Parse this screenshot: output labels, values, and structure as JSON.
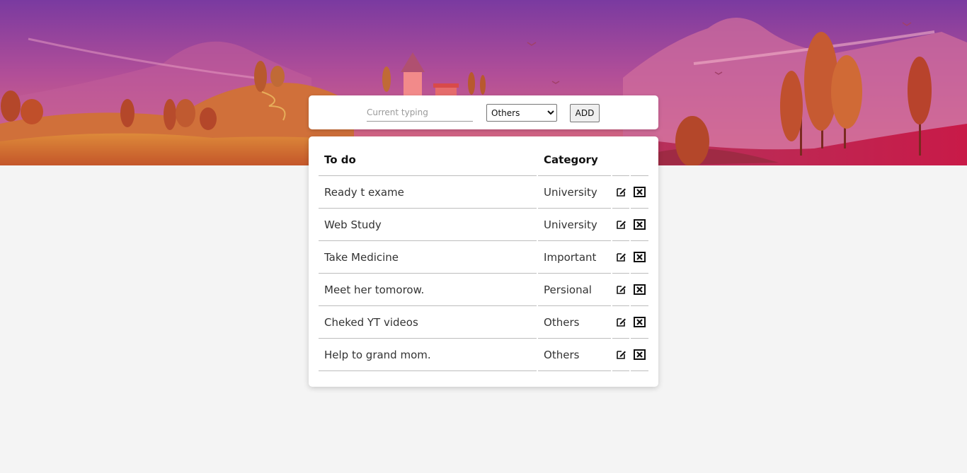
{
  "input": {
    "placeholder": "Current typing",
    "value": ""
  },
  "category_select": {
    "selected": "Others",
    "options": [
      "Others"
    ]
  },
  "add_button_label": "ADD",
  "table": {
    "headers": [
      "To do",
      "Category"
    ],
    "rows": [
      {
        "task": "Ready t exame",
        "category": "University"
      },
      {
        "task": "Web Study",
        "category": "University"
      },
      {
        "task": "Take Medicine",
        "category": "Important"
      },
      {
        "task": "Meet her tomorow.",
        "category": "Persional"
      },
      {
        "task": "Cheked YT videos",
        "category": "Others"
      },
      {
        "task": "Help to grand mom.",
        "category": "Others"
      }
    ],
    "row_actions": [
      "edit-icon",
      "delete-icon"
    ]
  },
  "colors": {
    "sky_top": "#7a3aa0",
    "sky_bottom": "#e06a7a",
    "hills": "#d8762e",
    "trees": "#b8441e",
    "page_background": "#f4f4f4",
    "card_background": "#ffffff"
  }
}
